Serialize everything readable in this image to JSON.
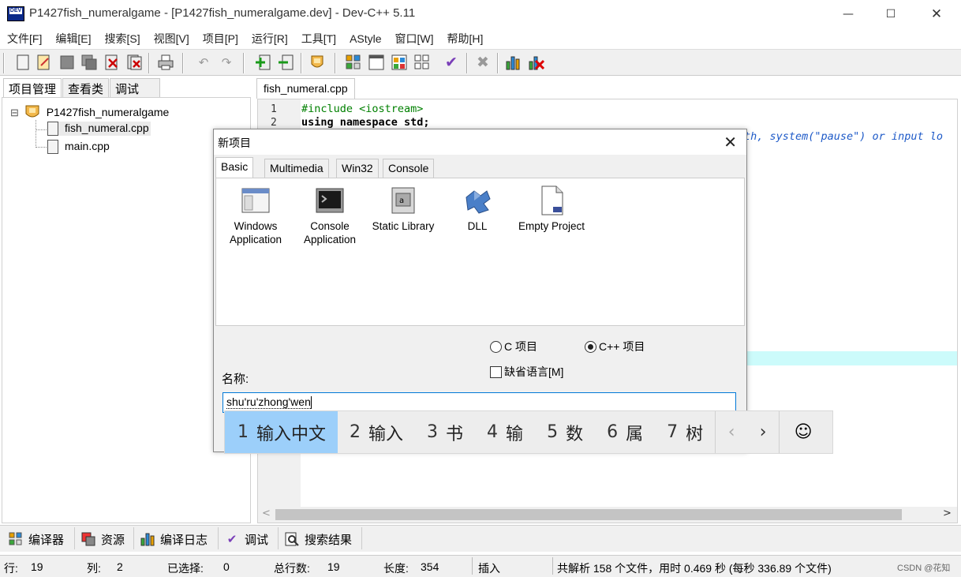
{
  "window": {
    "title": "P1427fish_numeralgame - [P1427fish_numeralgame.dev] - Dev-C++ 5.11",
    "icon_label": "DEV",
    "minimize_glyph": "—",
    "maximize_glyph": "☐",
    "close_glyph": "✕"
  },
  "menu": [
    "文件[F]",
    "编辑[E]",
    "搜索[S]",
    "视图[V]",
    "项目[P]",
    "运行[R]",
    "工具[T]",
    "AStyle",
    "窗口[W]",
    "帮助[H]"
  ],
  "toolbar_icons": [
    "new-file-icon",
    "open-icon",
    "save-icon",
    "save-all-icon",
    "close-icon",
    "close-all-icon",
    "print-icon",
    "undo-icon",
    "redo-icon",
    "add-to-project-icon",
    "remove-from-project-icon",
    "project-options-icon",
    "compile-icon",
    "run-icon",
    "compile-run-icon",
    "rebuild-icon",
    "syntax-check-icon",
    "stop-icon",
    "profile-icon",
    "delete-profile-icon"
  ],
  "left_tabs": [
    "项目管理",
    "查看类",
    "调试"
  ],
  "project_tree": {
    "collapse_glyph": "⊟",
    "root": "P1427fish_numeralgame",
    "files": [
      "fish_numeral.cpp",
      "main.cpp"
    ]
  },
  "editor": {
    "tab": "fish_numeral.cpp",
    "lines": [
      {
        "num": "1",
        "text": "#include <iostream>"
      },
      {
        "num": "2",
        "text": "using namespace std;"
      }
    ],
    "overflow_text": "th, system(\"pause\") or input lo",
    "scroll_left": "<",
    "scroll_right": ">"
  },
  "bottom_tabs": [
    "编译器",
    "资源",
    "编译日志",
    "调试",
    "搜索结果"
  ],
  "statusbar": {
    "row_label": "行:",
    "row_value": "19",
    "col_label": "列:",
    "col_value": "2",
    "sel_label": "已选择:",
    "sel_value": "0",
    "lines_label": "总行数:",
    "lines_value": "19",
    "len_label": "长度:",
    "len_value": "354",
    "mode": "插入",
    "message": "共解析 158 个文件，用时 0.469 秒 (每秒 336.89 个文件)",
    "watermark": "CSDN @花知"
  },
  "dialog": {
    "title": "新项目",
    "close_glyph": "✕",
    "tabs": [
      "Basic",
      "Multimedia",
      "Win32",
      "Console"
    ],
    "templates": [
      {
        "label_1": "Windows",
        "label_2": "Application",
        "icon": "windows-app-icon"
      },
      {
        "label_1": "Console",
        "label_2": "Application",
        "icon": "console-app-icon"
      },
      {
        "label_1": "Static Library",
        "label_2": "",
        "icon": "static-library-icon"
      },
      {
        "label_1": "DLL",
        "label_2": "",
        "icon": "dll-icon"
      },
      {
        "label_1": "Empty Project",
        "label_2": "",
        "icon": "empty-project-icon"
      }
    ],
    "radio_c": "C 项目",
    "radio_cpp": "C++ 项目",
    "selected_language": "C++ 项目",
    "default_language": "缺省语言[M]",
    "default_language_checked": false,
    "name_label": "名称:",
    "name_value": "shu'ru'zhong'wen"
  },
  "ime": {
    "candidates": [
      {
        "n": "1",
        "text": "输入中文"
      },
      {
        "n": "2",
        "text": "输入"
      },
      {
        "n": "3",
        "text": "书"
      },
      {
        "n": "4",
        "text": "输"
      },
      {
        "n": "5",
        "text": "数"
      },
      {
        "n": "6",
        "text": "属"
      },
      {
        "n": "7",
        "text": "树"
      }
    ],
    "selected_index": 0,
    "prev_glyph": "‹",
    "next_glyph": "›",
    "emoji_glyph": "☺"
  }
}
